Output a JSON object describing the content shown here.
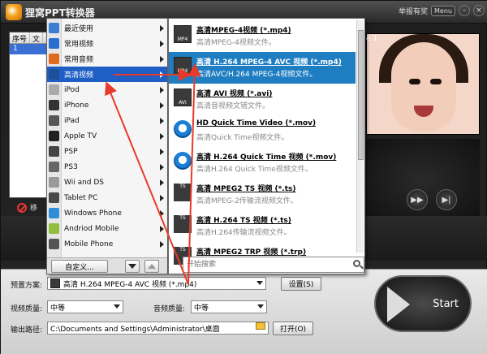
{
  "app": {
    "title": "狸窝PPT转换器",
    "report_label": "举报有奖",
    "menu_button": "Menu",
    "minimize": "–",
    "close": "×"
  },
  "file_list": {
    "columns": [
      "序号",
      "文"
    ],
    "rows": [
      {
        "index": "1"
      }
    ]
  },
  "delete_label": "移",
  "preview": {
    "label": "e 1"
  },
  "category_menu": {
    "items": [
      {
        "label": "最近使用",
        "icon": "clock-icon",
        "color": "#3c7fd1"
      },
      {
        "label": "常用视频",
        "icon": "video-icon",
        "color": "#2a6fcf"
      },
      {
        "label": "常用音频",
        "icon": "music-icon",
        "color": "#e06b1f"
      },
      {
        "label": "高清视频",
        "icon": "hd-icon",
        "color": "#1d4f9a"
      },
      {
        "label": "iPod",
        "icon": "ipod-icon",
        "color": "#aaaaaa"
      },
      {
        "label": "iPhone",
        "icon": "iphone-icon",
        "color": "#333333"
      },
      {
        "label": "iPad",
        "icon": "ipad-icon",
        "color": "#555555"
      },
      {
        "label": "Apple TV",
        "icon": "appletv-icon",
        "color": "#222222"
      },
      {
        "label": "PSP",
        "icon": "psp-icon",
        "color": "#444444"
      },
      {
        "label": "PS3",
        "icon": "ps3-icon",
        "color": "#666666"
      },
      {
        "label": "Wii and DS",
        "icon": "wii-icon",
        "color": "#999999"
      },
      {
        "label": "Tablet PC",
        "icon": "tablet-icon",
        "color": "#4a4a4a"
      },
      {
        "label": "Windows Phone",
        "icon": "winphone-icon",
        "color": "#2e8fd6"
      },
      {
        "label": "Andriod Mobile",
        "icon": "android-icon",
        "color": "#8fbf3c"
      },
      {
        "label": "Mobile Phone",
        "icon": "phone-icon",
        "color": "#555555"
      }
    ],
    "selected_index": 3,
    "custom_button": "自定义..."
  },
  "format_menu": {
    "items": [
      {
        "name": "高清MPEG-4视频 (*.mp4)",
        "desc": "高清MPEG-4视频文件。",
        "badge": "MP4"
      },
      {
        "name": "高清 H.264 MPEG-4 AVC 视频 (*.mp4)",
        "desc": "高清AVC/H.264 MPEG-4视频文件。",
        "badge": "MP4"
      },
      {
        "name": "高清 AVI 视频 (*.avi)",
        "desc": "高清音视频文错文件。",
        "badge": "AVI"
      },
      {
        "name": "HD Quick Time Video (*.mov)",
        "desc": "高清Quick Time视频文件。",
        "badge": "HD"
      },
      {
        "name": "高清 H.264 Quick Time 视频 (*.mov)",
        "desc": "高清H.264 Quick Time视频文件。",
        "badge": "HD"
      },
      {
        "name": "高清 MPEG2 TS 视频 (*.ts)",
        "desc": "高清MPEG-2传输流视频文件。",
        "badge": "TS"
      },
      {
        "name": "高清 H.264 TS 视频 (*.ts)",
        "desc": "高清H.264传输流视频文件。",
        "badge": "TS"
      },
      {
        "name": "高清 MPEG2 TRP 视频 (*.trp)",
        "desc": "",
        "badge": "TS"
      }
    ],
    "selected_index": 1,
    "search_placeholder": "开始搜索"
  },
  "settings": {
    "preset_label": "预置方案:",
    "preset_value": "高清 H.264 MPEG-4 AVC 视频 (*.mp4)",
    "settings_button": "设置(S)",
    "video_quality_label": "视频质量:",
    "video_quality_value": "中等",
    "audio_quality_label": "音频质量:",
    "audio_quality_value": "中等",
    "output_label": "输出路径:",
    "output_value": "C:\\Documents and Settings\\Administrator\\桌面",
    "open_button": "打开(O)",
    "start_button": "Start"
  },
  "colors": {
    "selection_blue": "#1f5fc5",
    "format_selection": "#1f7ec2",
    "annotation_red": "#e83a2a"
  }
}
